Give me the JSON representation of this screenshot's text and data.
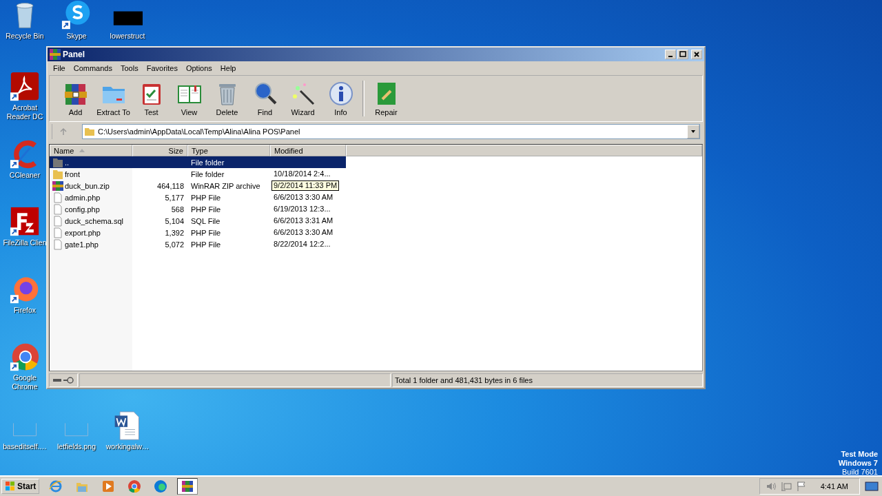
{
  "desktop_icons": [
    {
      "kind": "recycle",
      "label": "Recycle Bin",
      "shortcut": false
    },
    {
      "kind": "skype",
      "label": "Skype",
      "shortcut": true
    },
    {
      "kind": "black",
      "label": "lowerstruct",
      "shortcut": false
    },
    {
      "kind": "acrobat",
      "label": "Acrobat Reader DC",
      "shortcut": true
    },
    {
      "kind": "ccleaner",
      "label": "CCleaner",
      "shortcut": true
    },
    {
      "kind": "filezilla",
      "label": "FileZilla Clien",
      "shortcut": true
    },
    {
      "kind": "firefox",
      "label": "Firefox",
      "shortcut": true
    },
    {
      "kind": "chrome",
      "label": "Google Chrome",
      "shortcut": true
    },
    {
      "kind": "blank",
      "label": "baseditself.…",
      "shortcut": false
    },
    {
      "kind": "blank",
      "label": "letfields.png",
      "shortcut": false
    },
    {
      "kind": "word",
      "label": "workingalw…",
      "shortcut": false
    }
  ],
  "window": {
    "title": "Panel",
    "menu": [
      "File",
      "Commands",
      "Tools",
      "Favorites",
      "Options",
      "Help"
    ],
    "toolbar": [
      {
        "kind": "add",
        "label": "Add",
        "separator_before": false
      },
      {
        "kind": "extract",
        "label": "Extract To",
        "separator_before": false
      },
      {
        "kind": "test",
        "label": "Test",
        "separator_before": false
      },
      {
        "kind": "view",
        "label": "View",
        "separator_before": false
      },
      {
        "kind": "delete",
        "label": "Delete",
        "separator_before": false
      },
      {
        "kind": "find",
        "label": "Find",
        "separator_before": false
      },
      {
        "kind": "wizard",
        "label": "Wizard",
        "separator_before": false
      },
      {
        "kind": "info",
        "label": "Info",
        "separator_before": false
      },
      {
        "kind": "repair",
        "label": "Repair",
        "separator_before": true
      }
    ],
    "path": "C:\\Users\\admin\\AppData\\Local\\Temp\\Alina\\Alina POS\\Panel",
    "columns": [
      {
        "label": "Name",
        "sorted": true
      },
      {
        "label": "Size",
        "sorted": false
      },
      {
        "label": "Type",
        "sorted": false
      },
      {
        "label": "Modified",
        "sorted": false
      }
    ],
    "rows": [
      {
        "kind": "parent",
        "name": "..",
        "size": "",
        "type": "File folder",
        "modified": "",
        "selected": true,
        "tooltip": false
      },
      {
        "kind": "folder",
        "name": "front",
        "size": "",
        "type": "File folder",
        "modified": "10/18/2014 2:4...",
        "selected": false,
        "tooltip": false
      },
      {
        "kind": "archive",
        "name": "duck_bun.zip",
        "size": "464,118",
        "type": "WinRAR ZIP archive",
        "modified": "9/2/2014 11:33 PM",
        "selected": false,
        "tooltip": true
      },
      {
        "kind": "file",
        "name": "admin.php",
        "size": "5,177",
        "type": "PHP File",
        "modified": "6/6/2013 3:30 AM",
        "selected": false,
        "tooltip": false
      },
      {
        "kind": "file",
        "name": "config.php",
        "size": "568",
        "type": "PHP File",
        "modified": "6/19/2013 12:3...",
        "selected": false,
        "tooltip": false
      },
      {
        "kind": "file",
        "name": "duck_schema.sql",
        "size": "5,104",
        "type": "SQL File",
        "modified": "6/6/2013 3:31 AM",
        "selected": false,
        "tooltip": false
      },
      {
        "kind": "file",
        "name": "export.php",
        "size": "1,392",
        "type": "PHP File",
        "modified": "6/6/2013 3:30 AM",
        "selected": false,
        "tooltip": false
      },
      {
        "kind": "file",
        "name": "gate1.php",
        "size": "5,072",
        "type": "PHP File",
        "modified": "8/22/2014 12:2...",
        "selected": false,
        "tooltip": false
      }
    ],
    "status": "Total 1 folder and 481,431 bytes in 6 files"
  },
  "system_text": [
    "Test Mode",
    "Windows 7",
    "Build 7601"
  ],
  "taskbar": {
    "start": "Start",
    "apps": [
      {
        "kind": "ie",
        "active": false
      },
      {
        "kind": "explorer",
        "active": false
      },
      {
        "kind": "media",
        "active": false
      },
      {
        "kind": "chrome",
        "active": false
      },
      {
        "kind": "edge",
        "active": false
      },
      {
        "kind": "winrar",
        "active": true
      }
    ],
    "clock": "4:41 AM"
  }
}
